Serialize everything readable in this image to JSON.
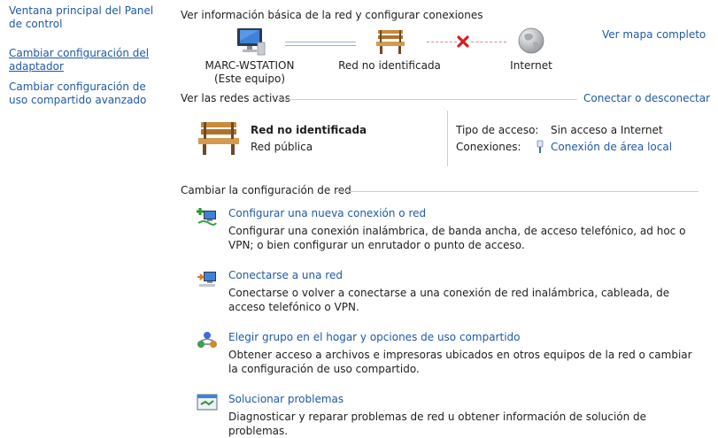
{
  "sidebar": {
    "items": [
      {
        "label": "Ventana principal del Panel de control"
      },
      {
        "label": "Cambiar configuración del adaptador"
      },
      {
        "label": "Cambiar configuración de uso compartido avanzado"
      }
    ]
  },
  "header": {
    "title": "Ver información básica de la red y configurar conexiones",
    "full_map_link": "Ver mapa completo"
  },
  "map": {
    "computer_name": "MARC-WSTATION",
    "computer_sub": "(Este equipo)",
    "network_name": "Red no identificada",
    "internet_label": "Internet"
  },
  "active": {
    "header": "Ver las redes activas",
    "connect_link": "Conectar o desconectar",
    "network_name": "Red no identificada",
    "network_type": "Red pública",
    "access_label": "Tipo de acceso:",
    "access_value": "Sin acceso a Internet",
    "connections_label": "Conexiones:",
    "connections_value": "Conexión de área local"
  },
  "change": {
    "header": "Cambiar la configuración de red",
    "tasks": [
      {
        "title": "Configurar una nueva conexión o red",
        "desc": "Configurar una conexión inalámbrica, de banda ancha, de acceso telefónico, ad hoc o VPN; o bien configurar un enrutador o punto de acceso."
      },
      {
        "title": "Conectarse a una red",
        "desc": "Conectarse o volver a conectarse a una conexión de red inalámbrica, cableada, de acceso telefónico o VPN."
      },
      {
        "title": "Elegir grupo en el hogar y opciones de uso compartido",
        "desc": "Obtener acceso a archivos e impresoras ubicados en otros equipos de la red o cambiar la configuración de uso compartido."
      },
      {
        "title": "Solucionar problemas",
        "desc": "Diagnosticar y reparar problemas de red u obtener información de solución de problemas."
      }
    ]
  }
}
